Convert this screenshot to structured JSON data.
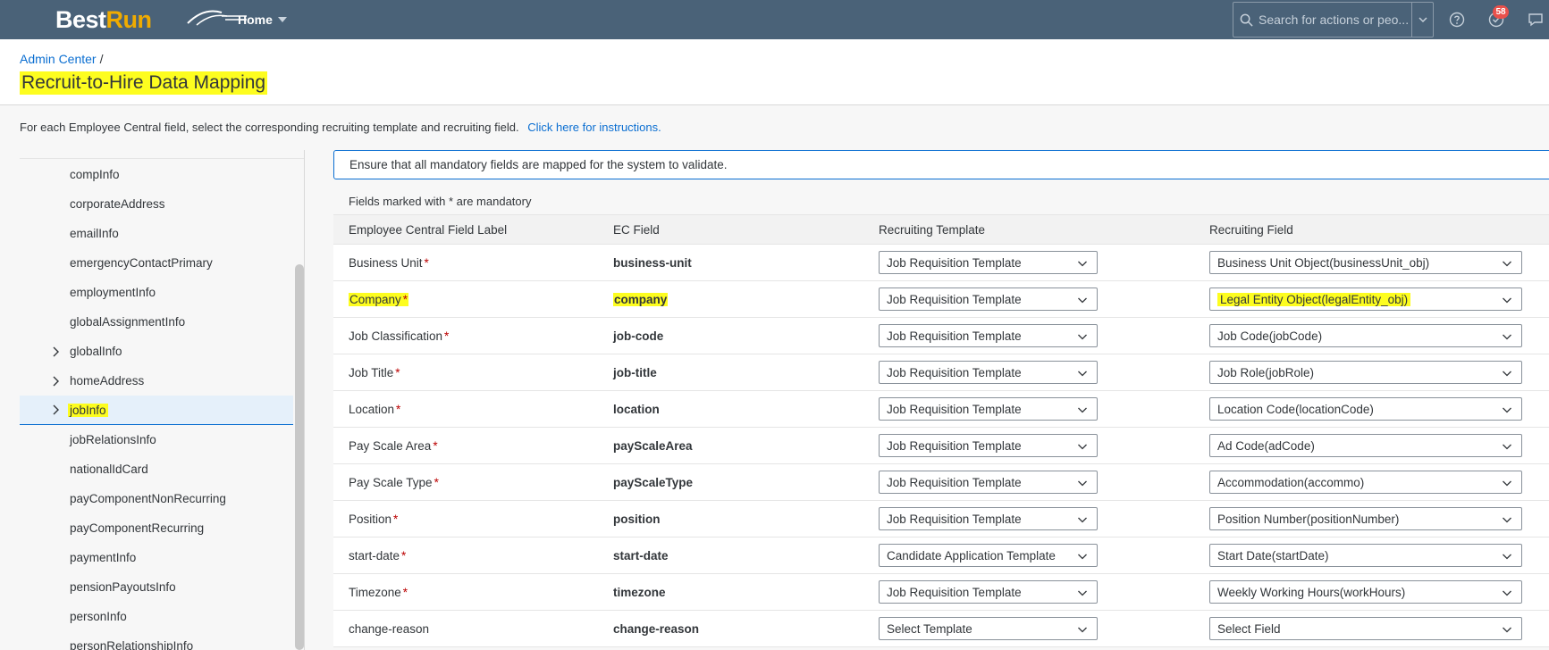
{
  "header": {
    "logo_part1": "Best",
    "logo_part2": "Run",
    "home_label": "Home",
    "search_placeholder": "Search for actions or peo...",
    "notification_count": "58"
  },
  "breadcrumb": {
    "parent": "Admin Center",
    "separator": "/"
  },
  "page": {
    "title": "Recruit-to-Hire Data Mapping",
    "instructions_text": "For each Employee Central field, select the corresponding recruiting template and recruiting field.",
    "instructions_link": "Click here for instructions."
  },
  "tree": {
    "items": [
      {
        "label": "compInfo",
        "expandable": false,
        "selected": false
      },
      {
        "label": "corporateAddress",
        "expandable": false,
        "selected": false
      },
      {
        "label": "emailInfo",
        "expandable": false,
        "selected": false
      },
      {
        "label": "emergencyContactPrimary",
        "expandable": false,
        "selected": false
      },
      {
        "label": "employmentInfo",
        "expandable": false,
        "selected": false
      },
      {
        "label": "globalAssignmentInfo",
        "expandable": false,
        "selected": false
      },
      {
        "label": "globalInfo",
        "expandable": true,
        "selected": false
      },
      {
        "label": "homeAddress",
        "expandable": true,
        "selected": false
      },
      {
        "label": "jobInfo",
        "expandable": true,
        "selected": true
      },
      {
        "label": "jobRelationsInfo",
        "expandable": false,
        "selected": false
      },
      {
        "label": "nationalIdCard",
        "expandable": false,
        "selected": false
      },
      {
        "label": "payComponentNonRecurring",
        "expandable": false,
        "selected": false
      },
      {
        "label": "payComponentRecurring",
        "expandable": false,
        "selected": false
      },
      {
        "label": "paymentInfo",
        "expandable": false,
        "selected": false
      },
      {
        "label": "pensionPayoutsInfo",
        "expandable": false,
        "selected": false
      },
      {
        "label": "personInfo",
        "expandable": false,
        "selected": false
      },
      {
        "label": "personRelationshipInfo",
        "expandable": false,
        "selected": false
      }
    ]
  },
  "main": {
    "message": "Ensure that all mandatory fields are mapped for the system to validate.",
    "mandatory_note": "Fields marked with * are mandatory",
    "columns": [
      "Employee Central Field Label",
      "EC Field",
      "Recruiting Template",
      "Recruiting Field"
    ],
    "rows": [
      {
        "label": "Business Unit",
        "required": true,
        "field": "business-unit",
        "template": "Job Requisition Template",
        "recruiting_field": "Business Unit Object(businessUnit_obj)",
        "highlight": false
      },
      {
        "label": "Company",
        "required": true,
        "field": "company",
        "template": "Job Requisition Template",
        "recruiting_field": "Legal Entity Object(legalEntity_obj)",
        "highlight": true
      },
      {
        "label": "Job Classification",
        "required": true,
        "field": "job-code",
        "template": "Job Requisition Template",
        "recruiting_field": "Job Code(jobCode)",
        "highlight": false
      },
      {
        "label": "Job Title",
        "required": true,
        "field": "job-title",
        "template": "Job Requisition Template",
        "recruiting_field": "Job Role(jobRole)",
        "highlight": false
      },
      {
        "label": "Location",
        "required": true,
        "field": "location",
        "template": "Job Requisition Template",
        "recruiting_field": "Location Code(locationCode)",
        "highlight": false
      },
      {
        "label": "Pay Scale Area",
        "required": true,
        "field": "payScaleArea",
        "template": "Job Requisition Template",
        "recruiting_field": "Ad Code(adCode)",
        "highlight": false
      },
      {
        "label": "Pay Scale Type",
        "required": true,
        "field": "payScaleType",
        "template": "Job Requisition Template",
        "recruiting_field": "Accommodation(accommo)",
        "highlight": false
      },
      {
        "label": "Position",
        "required": true,
        "field": "position",
        "template": "Job Requisition Template",
        "recruiting_field": "Position Number(positionNumber)",
        "highlight": false
      },
      {
        "label": "start-date",
        "required": true,
        "field": "start-date",
        "template": "Candidate Application Template",
        "recruiting_field": "Start Date(startDate)",
        "highlight": false
      },
      {
        "label": "Timezone",
        "required": true,
        "field": "timezone",
        "template": "Job Requisition Template",
        "recruiting_field": "Weekly Working Hours(workHours)",
        "highlight": false
      },
      {
        "label": "change-reason",
        "required": false,
        "field": "change-reason",
        "template": "Select Template",
        "recruiting_field": "Select Field",
        "highlight": false
      }
    ]
  },
  "colors": {
    "shell": "#4a6278",
    "accent": "#0a6ed1",
    "highlight": "#fdfd1f",
    "required": "#bb0000",
    "brand_orange": "#f0ab00"
  }
}
